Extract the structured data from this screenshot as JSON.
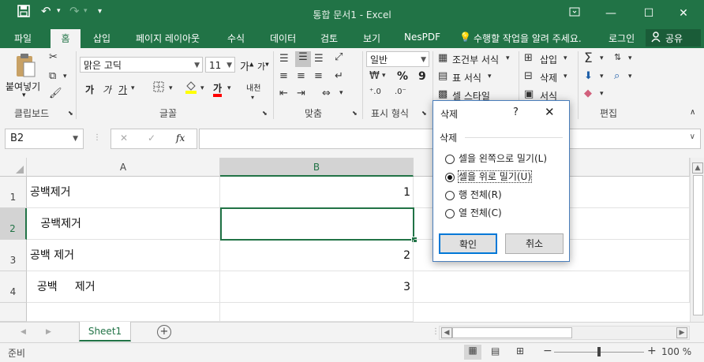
{
  "title_bar": {
    "title": "통합 문서1 - Excel",
    "save_icon": "save-icon",
    "undo_icon": "undo-icon",
    "redo_icon": "redo-icon",
    "qa_menu": "▾",
    "ribbon_opts_icon": "ribbon-display-icon",
    "minimize": "—",
    "maximize": "☐",
    "close": "✕"
  },
  "tabs": {
    "file": "파일",
    "home": "홈",
    "insert": "삽입",
    "layout": "페이지 레이아웃",
    "formulas": "수식",
    "data": "데이터",
    "review": "검토",
    "view": "보기",
    "nespdf": "NesPDF",
    "tellme": "수행할 작업을 알려 주세요.",
    "signin": "로그인",
    "share": "공유"
  },
  "ribbon": {
    "clipboard": {
      "label": "클립보드",
      "paste": "붙여넣기"
    },
    "font": {
      "label": "글꼴",
      "name": "맑은 고딕",
      "size": "11",
      "bold": "가",
      "italic": "가",
      "underline": "가",
      "grow": "가",
      "shrink": "가",
      "color": "가",
      "phonetic": "내천"
    },
    "alignment": {
      "label": "맞춤"
    },
    "number": {
      "label": "표시 형식",
      "format": "일반",
      "percent": "%",
      "comma": "9"
    },
    "styles": {
      "cond": "조건부 서식",
      "table": "표 서식",
      "cell": "셀 스타일"
    },
    "cells": {
      "insert": "삽입",
      "delete": "삭제",
      "format": "서식"
    },
    "editing": {
      "label": "편집"
    }
  },
  "formula_bar": {
    "name_box": "B2",
    "cancel": "✕",
    "enter": "✓",
    "fx": "fx",
    "content": ""
  },
  "grid": {
    "columns": [
      "A",
      "B"
    ],
    "rows": [
      {
        "num": "1",
        "a": "공백제거",
        "b": "1"
      },
      {
        "num": "2",
        "a": "   공백제거",
        "b": ""
      },
      {
        "num": "3",
        "a": "공백 제거",
        "b": "2"
      },
      {
        "num": "4",
        "a": "  공백     제거",
        "b": "3"
      }
    ]
  },
  "sheet_tabs": {
    "sheet1": "Sheet1",
    "add": "+"
  },
  "status_bar": {
    "status": "준비",
    "zoom_out": "−",
    "zoom_in": "+",
    "zoom": "100 %"
  },
  "dialog": {
    "title": "삭제",
    "help": "?",
    "close": "✕",
    "group_label": "삭제",
    "options": [
      {
        "label": "셀을 왼쪽으로 밀기(L)",
        "selected": false
      },
      {
        "label": "셀을 위로 밀기(U)",
        "selected": true
      },
      {
        "label": "행 전체(R)",
        "selected": false
      },
      {
        "label": "열 전체(C)",
        "selected": false
      }
    ],
    "ok": "확인",
    "cancel": "취소"
  },
  "colors": {
    "brand": "#217346",
    "selection": "#217346",
    "dialog_border": "#4a7ebb"
  }
}
